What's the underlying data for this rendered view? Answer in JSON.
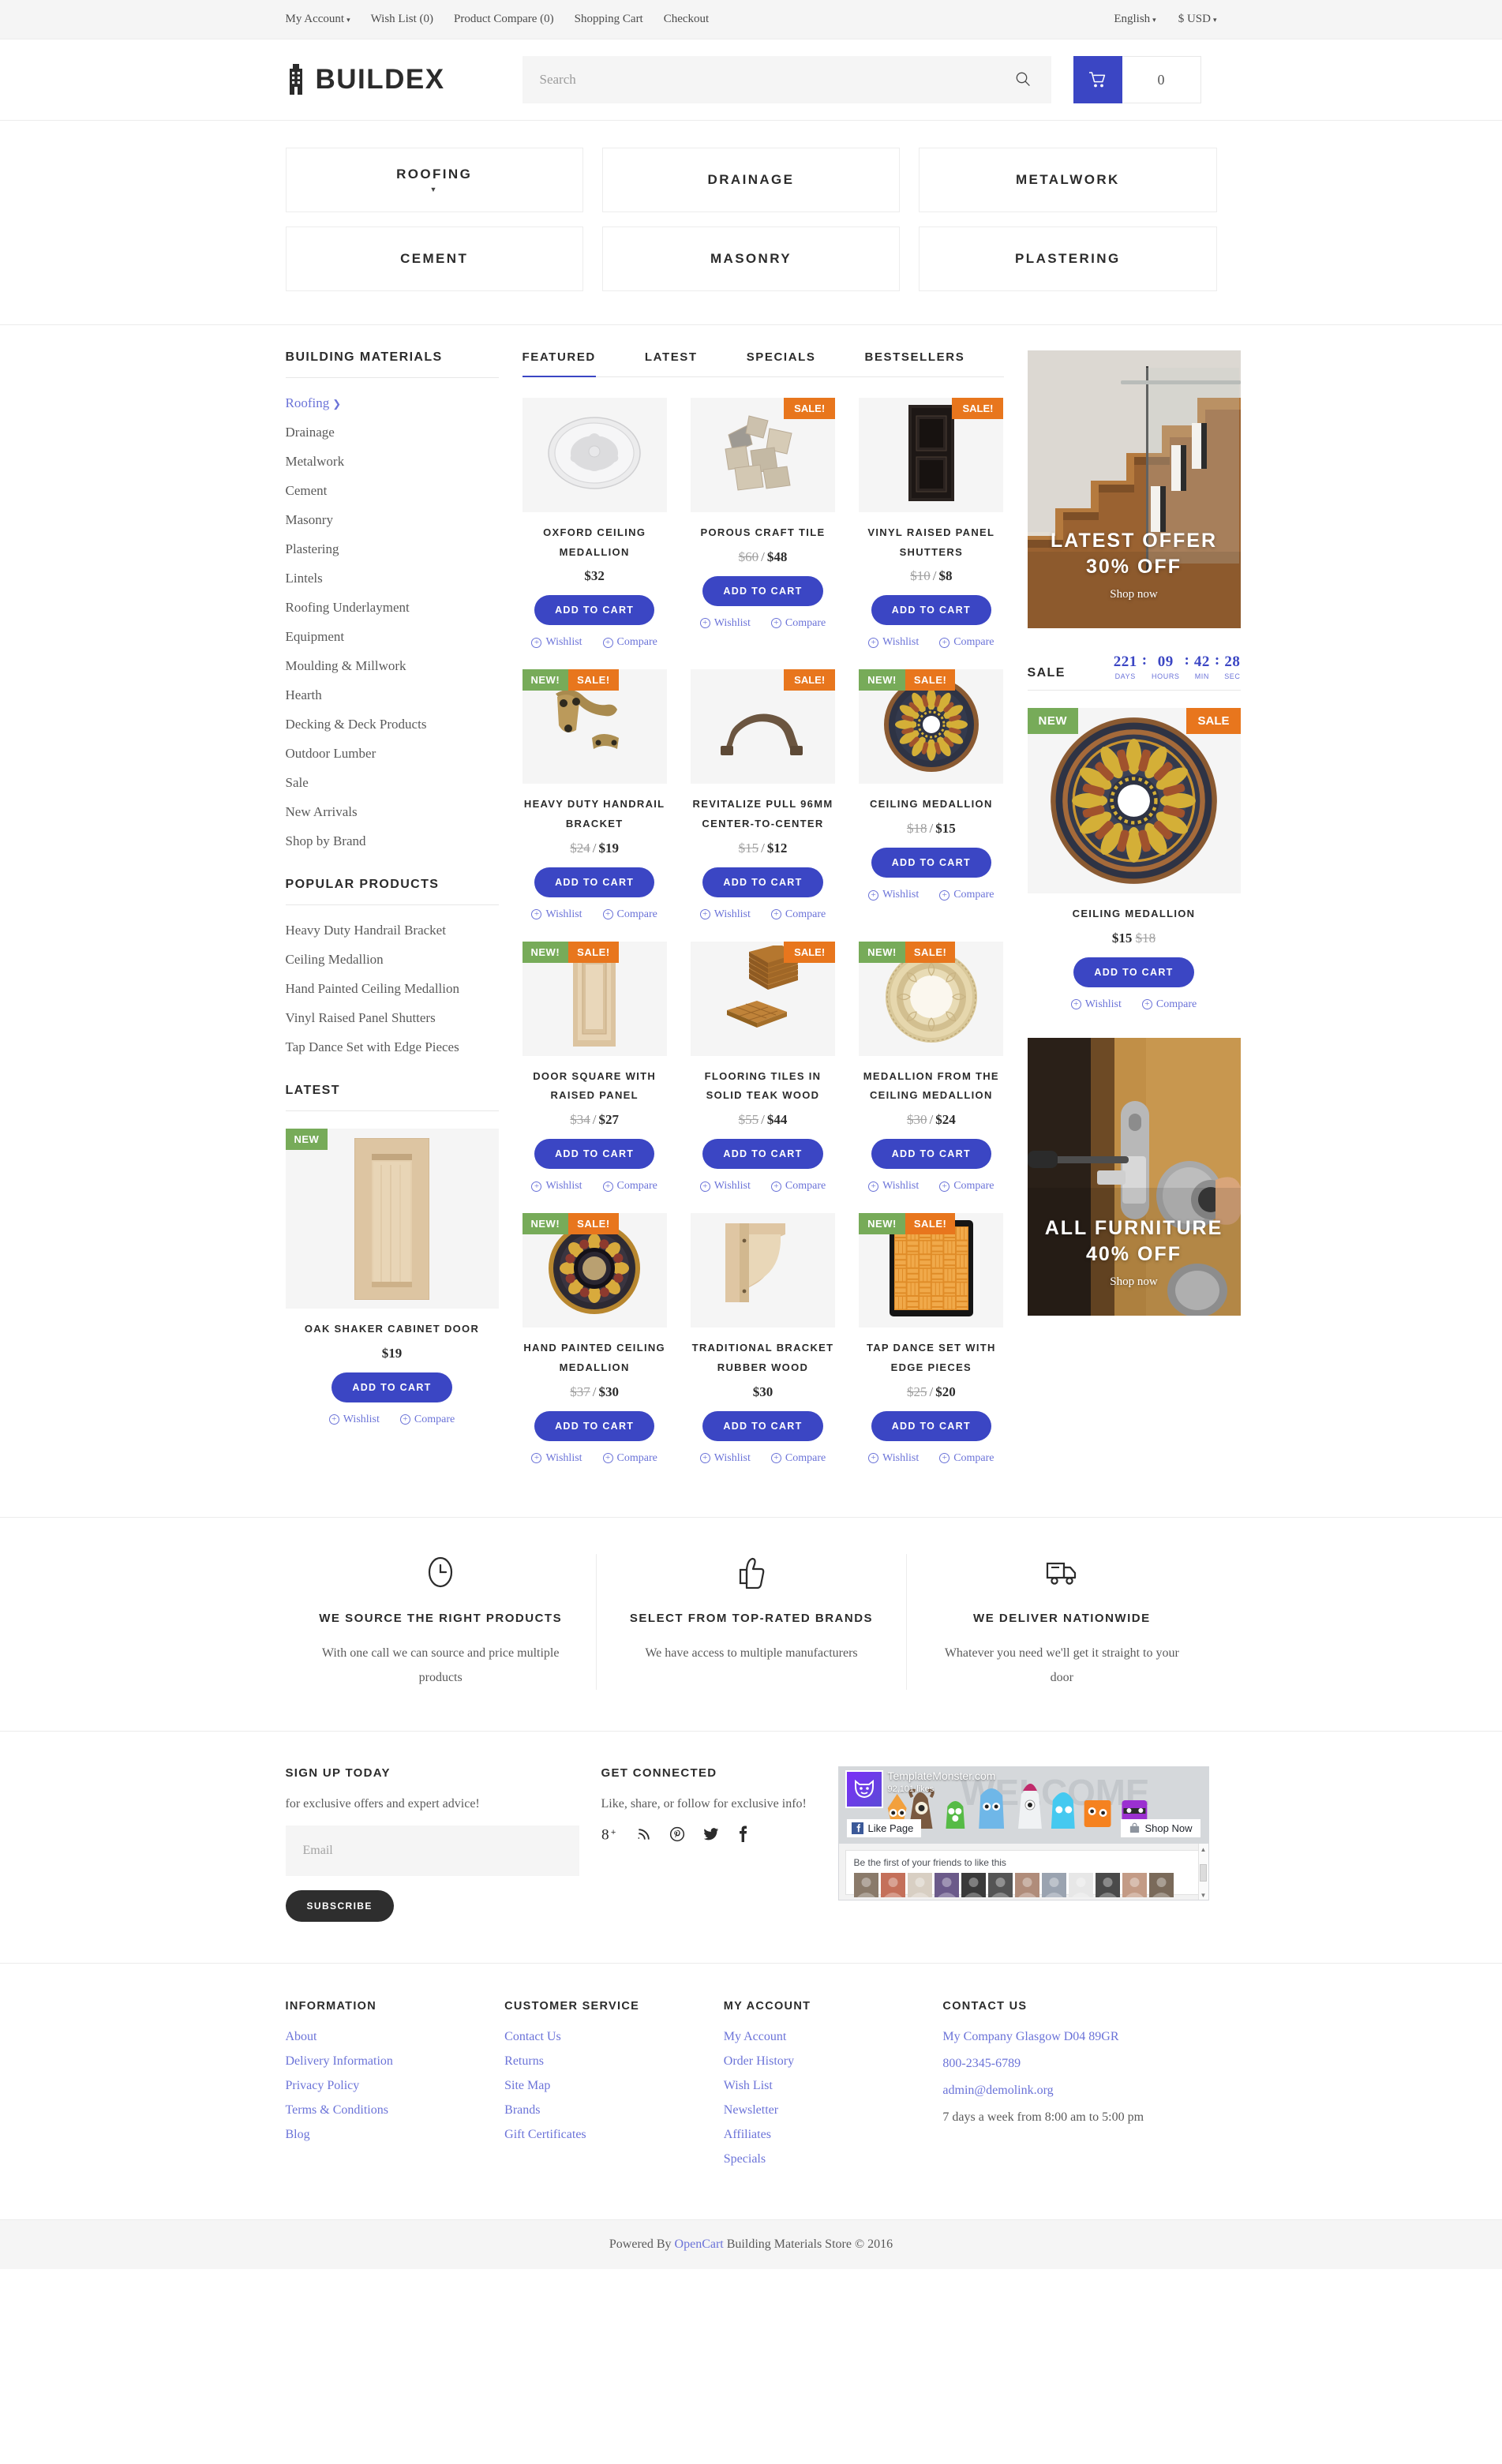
{
  "topbar": {
    "left": [
      {
        "label": "My Account",
        "caret": true
      },
      {
        "label": "Wish List (0)",
        "caret": false
      },
      {
        "label": "Product Compare (0)",
        "caret": false
      },
      {
        "label": "Shopping Cart",
        "caret": false
      },
      {
        "label": "Checkout",
        "caret": false
      }
    ],
    "language": "English",
    "currency": "$ USD"
  },
  "header": {
    "logo_text": "BUILDEX",
    "logo_icon": "building-icon",
    "search_placeholder": "Search",
    "search_value": "",
    "search_icon": "search-icon",
    "cart_icon": "shopping-cart-icon",
    "cart_count": "0"
  },
  "categories": [
    {
      "label": "ROOFING",
      "caret": true
    },
    {
      "label": "DRAINAGE",
      "caret": false
    },
    {
      "label": "METALWORK",
      "caret": false
    },
    {
      "label": "CEMENT",
      "caret": false
    },
    {
      "label": "MASONRY",
      "caret": false
    },
    {
      "label": "PLASTERING",
      "caret": false
    }
  ],
  "sidebar": {
    "materials_heading": "BUILDING MATERIALS",
    "materials": [
      {
        "label": "Roofing",
        "active": true,
        "arrow": true
      },
      {
        "label": "Drainage",
        "active": false,
        "arrow": false
      },
      {
        "label": "Metalwork",
        "active": false,
        "arrow": false
      },
      {
        "label": "Cement",
        "active": false,
        "arrow": false
      },
      {
        "label": "Masonry",
        "active": false,
        "arrow": false
      },
      {
        "label": "Plastering",
        "active": false,
        "arrow": false
      },
      {
        "label": "Lintels",
        "active": false,
        "arrow": false
      },
      {
        "label": "Roofing Underlayment",
        "active": false,
        "arrow": false
      },
      {
        "label": "Equipment",
        "active": false,
        "arrow": false
      },
      {
        "label": "Moulding & Millwork",
        "active": false,
        "arrow": false
      },
      {
        "label": "Hearth",
        "active": false,
        "arrow": false
      },
      {
        "label": "Decking & Deck Products",
        "active": false,
        "arrow": false
      },
      {
        "label": "Outdoor Lumber",
        "active": false,
        "arrow": false
      },
      {
        "label": "Sale",
        "active": false,
        "arrow": false
      },
      {
        "label": "New Arrivals",
        "active": false,
        "arrow": false
      },
      {
        "label": "Shop by Brand",
        "active": false,
        "arrow": false
      }
    ],
    "popular_heading": "POPULAR PRODUCTS",
    "popular": [
      "Heavy Duty Handrail Bracket",
      "Ceiling Medallion",
      "Hand Painted Ceiling Medallion",
      "Vinyl Raised Panel Shutters",
      "Tap Dance Set with Edge Pieces"
    ],
    "latest_heading": "LATEST",
    "latest_product": {
      "title": "OAK SHAKER CABINET DOOR",
      "price": "$19",
      "badge_new": "NEW",
      "add_to_cart": "ADD TO CART",
      "wishlist": "Wishlist",
      "compare": "Compare"
    }
  },
  "tabs": [
    {
      "label": "FEATURED",
      "active": true
    },
    {
      "label": "LATEST",
      "active": false
    },
    {
      "label": "SPECIALS",
      "active": false
    },
    {
      "label": "BESTSELLERS",
      "active": false
    }
  ],
  "labels": {
    "add_to_cart": "ADD TO CART",
    "wishlist": "Wishlist",
    "compare": "Compare",
    "badge_new": "NEW!",
    "badge_sale": "SALE!"
  },
  "products": [
    {
      "title": "OXFORD CEILING MEDALLION",
      "old_price": "",
      "price": "$32",
      "new": false,
      "sale": false,
      "img": "ceiling-medallion-white"
    },
    {
      "title": "POROUS CRAFT TILE",
      "old_price": "$60",
      "price": "$48",
      "new": false,
      "sale": true,
      "sale_right": true,
      "img": "craft-tile"
    },
    {
      "title": "VINYL RAISED PANEL SHUTTERS",
      "old_price": "$10",
      "price": "$8",
      "new": false,
      "sale": true,
      "sale_right": true,
      "img": "dark-shutter"
    },
    {
      "title": "HEAVY DUTY HANDRAIL BRACKET",
      "old_price": "$24",
      "price": "$19",
      "new": true,
      "sale": true,
      "img": "brass-bracket"
    },
    {
      "title": "REVITALIZE PULL 96MM CENTER-TO-CENTER",
      "old_price": "$15",
      "price": "$12",
      "new": false,
      "sale": true,
      "sale_right": true,
      "img": "bronze-pull"
    },
    {
      "title": "CEILING MEDALLION",
      "old_price": "$18",
      "price": "$15",
      "new": true,
      "sale": true,
      "img": "gold-medallion"
    },
    {
      "title": "DOOR SQUARE WITH RAISED PANEL",
      "old_price": "$34",
      "price": "$27",
      "new": true,
      "sale": true,
      "img": "wood-door-panel"
    },
    {
      "title": "FLOORING TILES IN SOLID TEAK WOOD",
      "old_price": "$55",
      "price": "$44",
      "new": false,
      "sale": true,
      "sale_right": true,
      "img": "teak-tiles"
    },
    {
      "title": "MEDALLION FROM THE CEILING MEDALLION",
      "old_price": "$30",
      "price": "$24",
      "new": true,
      "sale": true,
      "img": "cream-medallion"
    },
    {
      "title": "HAND PAINTED CEILING MEDALLION",
      "old_price": "$37",
      "price": "$30",
      "new": true,
      "sale": true,
      "img": "painted-medallion"
    },
    {
      "title": "TRADITIONAL BRACKET RUBBER WOOD",
      "old_price": "",
      "price": "$30",
      "new": false,
      "sale": false,
      "img": "wood-corbel"
    },
    {
      "title": "TAP DANCE SET WITH EDGE PIECES",
      "old_price": "$25",
      "price": "$20",
      "new": true,
      "sale": true,
      "img": "tap-dance-tile"
    }
  ],
  "right": {
    "banner1": {
      "line1": "LATEST OFFER",
      "line2": "30% OFF",
      "cta": "Shop now"
    },
    "sale_label": "SALE",
    "countdown": [
      {
        "num": "221",
        "unit": "DAYS"
      },
      {
        "num": "09",
        "unit": "HOURS"
      },
      {
        "num": "42",
        "unit": "MIN"
      },
      {
        "num": "28",
        "unit": "SEC"
      }
    ],
    "sale_product": {
      "title": "CEILING MEDALLION",
      "price": "$15",
      "old_price": "$18",
      "badge_new": "NEW",
      "badge_sale": "SALE",
      "add_to_cart": "ADD TO CART",
      "wishlist": "Wishlist",
      "compare": "Compare"
    },
    "banner2": {
      "line1": "ALL FURNITURE",
      "line2": "40% OFF",
      "cta": "Shop now"
    }
  },
  "features": [
    {
      "icon": "clock-icon",
      "title": "WE SOURCE THE RIGHT PRODUCTS",
      "desc": "With one call we can source and price multiple products"
    },
    {
      "icon": "thumbs-up-icon",
      "title": "SELECT FROM TOP-RATED BRANDS",
      "desc": "We have access to multiple manufacturers"
    },
    {
      "icon": "delivery-truck-icon",
      "title": "WE DELIVER NATIONWIDE",
      "desc": "Whatever you need we'll get it straight to your door"
    }
  ],
  "newsletter": {
    "heading": "SIGN UP TODAY",
    "subtext": "for exclusive offers and expert advice!",
    "email_placeholder": "Email",
    "email_value": "",
    "subscribe": "SUBSCRIBE"
  },
  "connected": {
    "heading": "GET CONNECTED",
    "subtext": "Like, share, or follow for exclusive info!",
    "icons": [
      "google-plus-icon",
      "rss-icon",
      "pinterest-icon",
      "twitter-icon",
      "facebook-icon"
    ]
  },
  "fb_widget": {
    "page_name": "TemplateMonster.com",
    "likes": "92,101 likes",
    "like_button": "Like Page",
    "shop_button": "Shop Now",
    "be_first": "Be the first of your friends to like this"
  },
  "footer": {
    "columns": [
      {
        "heading": "INFORMATION",
        "links": [
          "About",
          "Delivery Information",
          "Privacy Policy",
          "Terms & Conditions",
          "Blog"
        ]
      },
      {
        "heading": "CUSTOMER SERVICE",
        "links": [
          "Contact Us",
          "Returns",
          "Site Map",
          "Brands",
          "Gift Certificates"
        ]
      },
      {
        "heading": "MY ACCOUNT",
        "links": [
          "My Account",
          "Order History",
          "Wish List",
          "Newsletter",
          "Affiliates",
          "Specials"
        ]
      }
    ],
    "contact": {
      "heading": "CONTACT US",
      "address": "My Company Glasgow D04 89GR",
      "phone": "800-2345-6789",
      "email": "admin@demolink.org",
      "hours": "7 days a week from 8:00 am to 5:00 pm"
    }
  },
  "copyright": {
    "prefix": "Powered By ",
    "link": "OpenCart",
    "suffix": " Building Materials Store © 2016"
  },
  "colors": {
    "accent": "#3b46c4",
    "link": "#6b73d8",
    "sale_badge": "#e8761d",
    "new_badge": "#77ab59",
    "dark": "#2b2b2b"
  }
}
